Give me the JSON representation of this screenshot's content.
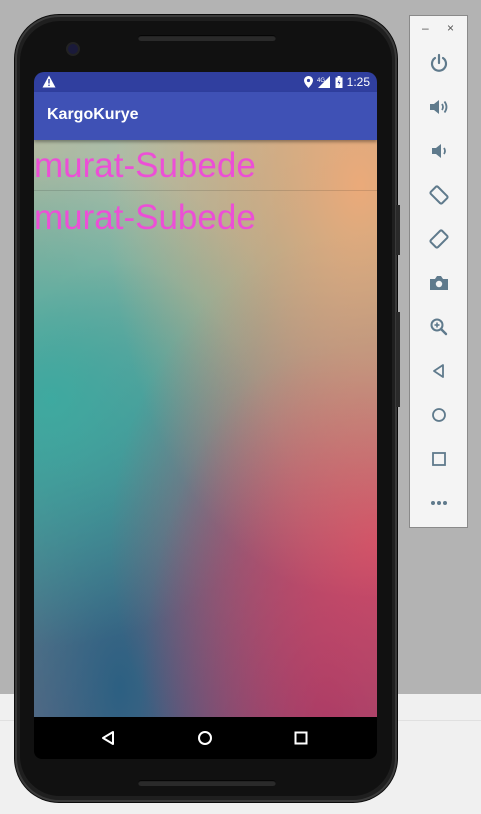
{
  "status_bar": {
    "time": "1:25",
    "network": "4G"
  },
  "app_bar": {
    "title": "KargoKurye"
  },
  "content": {
    "lines": [
      "murat-Subede",
      "murat-Subede"
    ]
  },
  "emulator_toolbar": {
    "window_controls": [
      "–",
      "×"
    ],
    "buttons": [
      "power-icon",
      "volume-up-icon",
      "volume-down-icon",
      "rotate-left-icon",
      "rotate-right-icon",
      "camera-icon",
      "zoom-icon",
      "back-icon",
      "home-icon",
      "overview-icon",
      "more-icon"
    ]
  },
  "nav_bar": {
    "buttons": [
      "back-icon",
      "home-icon",
      "recents-icon"
    ]
  },
  "colors": {
    "status_bar": "#303f9f",
    "app_bar": "#3f51b5",
    "label_text": "#ec4fd6",
    "toolbar_icon": "#5f7a8c"
  }
}
